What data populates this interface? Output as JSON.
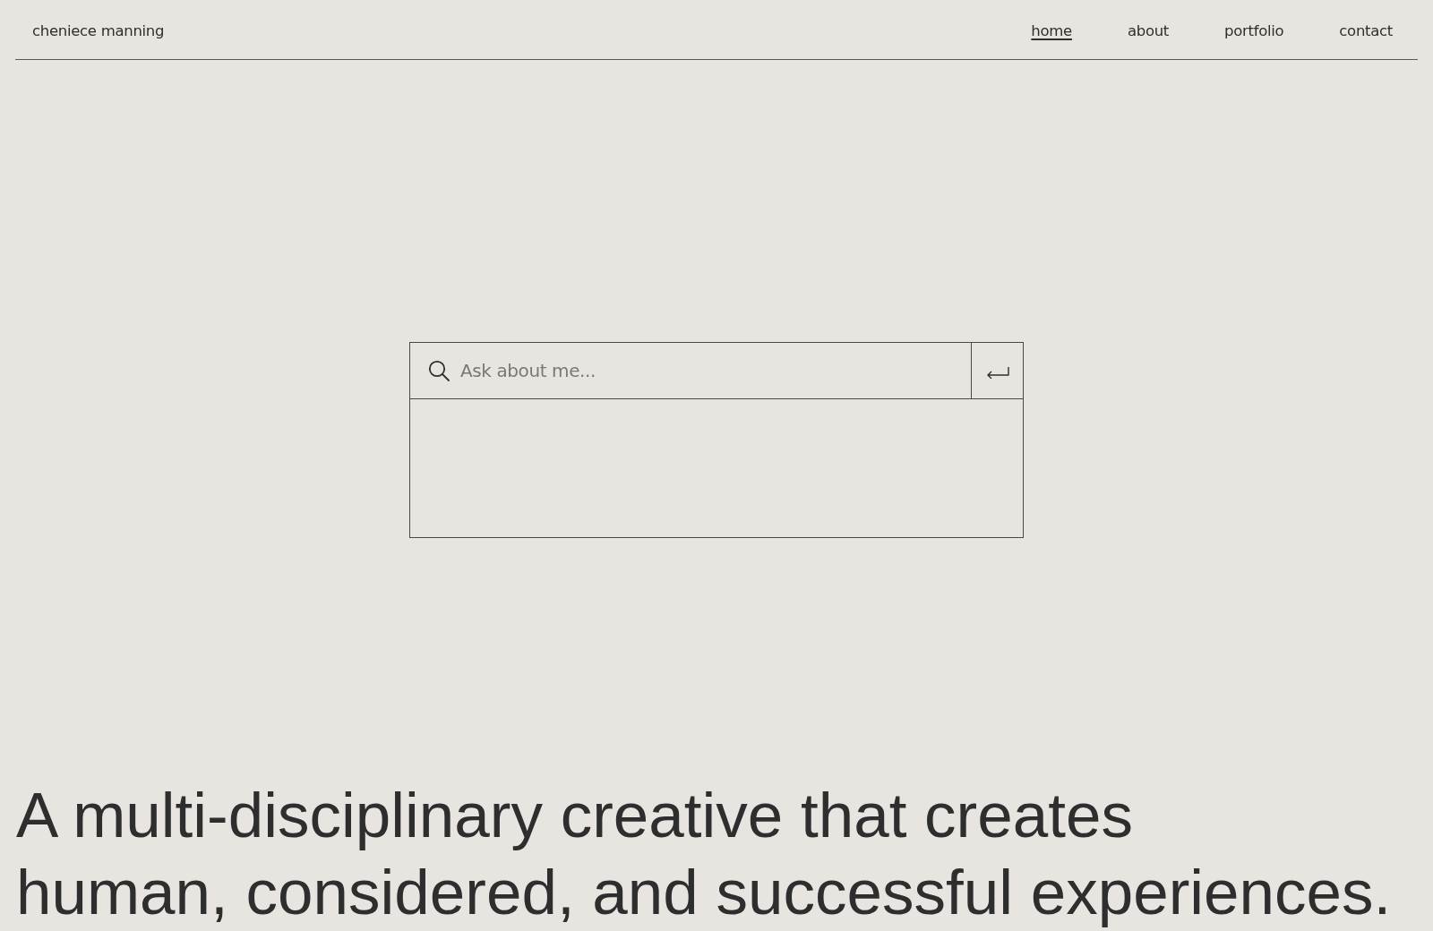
{
  "header": {
    "logo": "cheniece manning",
    "nav": [
      {
        "label": "home",
        "selected": true
      },
      {
        "label": "about",
        "selected": false
      },
      {
        "label": "portfolio",
        "selected": false
      },
      {
        "label": "contact",
        "selected": false
      }
    ]
  },
  "search": {
    "placeholder": "Ask about me..."
  },
  "headline": {
    "lines": [
      "A multi-disciplinary creative that creates",
      "human, considered, and successful experiences."
    ]
  }
}
